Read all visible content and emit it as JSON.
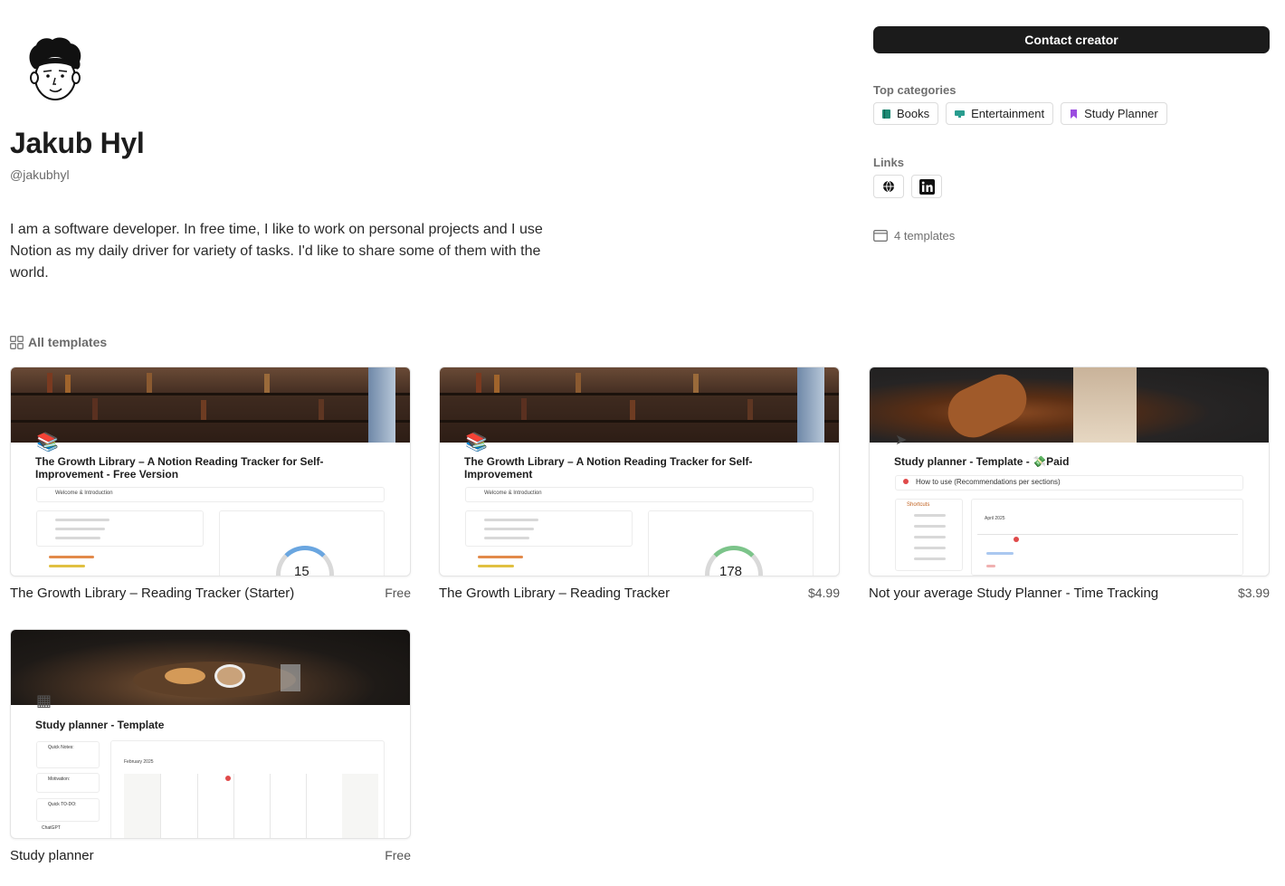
{
  "profile": {
    "name": "Jakub Hyl",
    "handle": "@jakubhyl",
    "bio": "I am a software developer. In free time, I like to work on personal projects and I use Notion as my daily driver for variety of tasks. I'd like to share some of them with the world."
  },
  "sidebar": {
    "contact_label": "Contact creator",
    "top_categories_label": "Top categories",
    "categories": [
      {
        "label": "Books",
        "icon": "book-icon",
        "color": "#1d8a74"
      },
      {
        "label": "Entertainment",
        "icon": "monitor-icon",
        "color": "#2a9d8f"
      },
      {
        "label": "Study Planner",
        "icon": "bookmark-icon",
        "color": "#9b4de0"
      }
    ],
    "links_label": "Links",
    "links": [
      {
        "icon": "globe-icon"
      },
      {
        "icon": "linkedin-icon"
      }
    ],
    "templates_count": "4 templates"
  },
  "templates_section": {
    "label": "All templates",
    "cards": [
      {
        "name": "The Growth Library – Reading Tracker (Starter)",
        "price": "Free",
        "preview_title": "The Growth Library – A Notion Reading Tracker for Self-Improvement - Free Version",
        "preview_toggle": "Welcome & Introduction",
        "preview_count": "15",
        "page_icon": "📚"
      },
      {
        "name": "The Growth Library – Reading Tracker",
        "price": "$4.99",
        "preview_title": "The Growth Library – A Notion Reading Tracker for Self-Improvement",
        "preview_toggle": "Welcome & Introduction",
        "preview_count": "178",
        "page_icon": "📚"
      },
      {
        "name": "Not your average Study Planner - Time Tracking",
        "price": "$3.99",
        "preview_title": "Study planner - Template - 💸Paid",
        "preview_toggle": "How to use (Recommendations per sections)",
        "preview_shortcuts": "Shortcuts",
        "preview_month": "April 2025",
        "page_icon": "➤"
      },
      {
        "name": "Study planner",
        "price": "Free",
        "preview_title": "Study planner - Template",
        "preview_month": "February 2025",
        "preview_quick_notes": "Quick Notes:",
        "preview_motivation": "Motivation:",
        "preview_todo": "Quick TO-DO:",
        "preview_chatgpt": "ChatGPT",
        "page_icon": "▦"
      }
    ]
  }
}
